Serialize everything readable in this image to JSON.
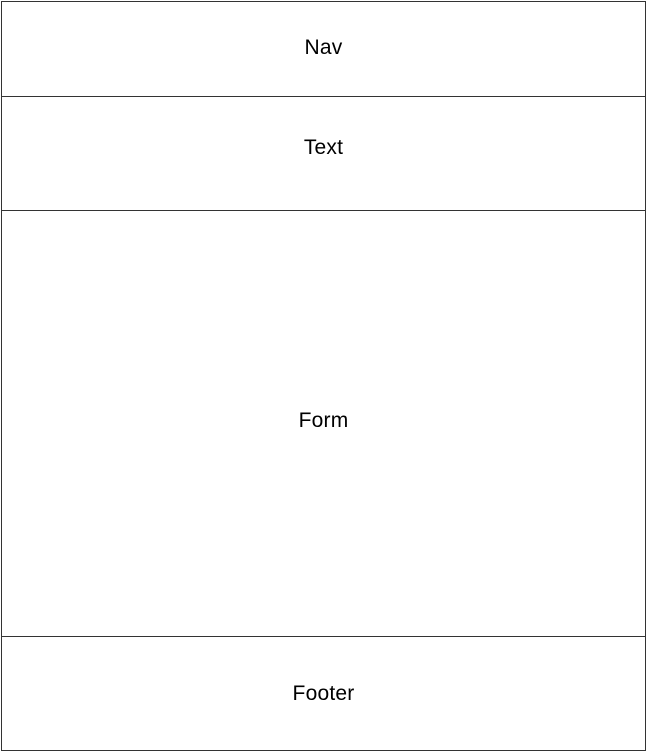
{
  "wireframe": {
    "nav_label": "Nav",
    "text_label": "Text",
    "form_label": "Form",
    "footer_label": "Footer"
  }
}
